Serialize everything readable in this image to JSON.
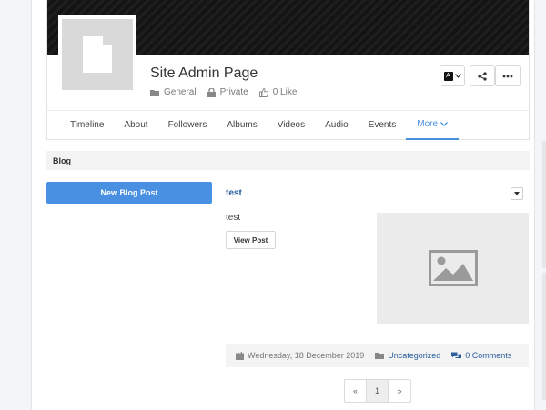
{
  "profile": {
    "title": "Site Admin Page",
    "category": "General",
    "privacy": "Private",
    "likes": "0 Like"
  },
  "actions": {
    "lang_badge": "A"
  },
  "tabs": [
    {
      "label": "Timeline"
    },
    {
      "label": "About"
    },
    {
      "label": "Followers"
    },
    {
      "label": "Albums"
    },
    {
      "label": "Videos"
    },
    {
      "label": "Audio"
    },
    {
      "label": "Events"
    },
    {
      "label": "More"
    }
  ],
  "section": {
    "title": "Blog"
  },
  "sidebar": {
    "new_post_label": "New Blog Post"
  },
  "post": {
    "title": "test",
    "excerpt": "test",
    "view_label": "View Post",
    "date": "Wednesday, 18 December 2019",
    "category": "Uncategorized",
    "comments": "0 Comments"
  },
  "pagination": {
    "prev": "«",
    "current": "1",
    "next": "»"
  },
  "colors": {
    "accent": "#4a90e2",
    "link": "#2b5f9e"
  }
}
